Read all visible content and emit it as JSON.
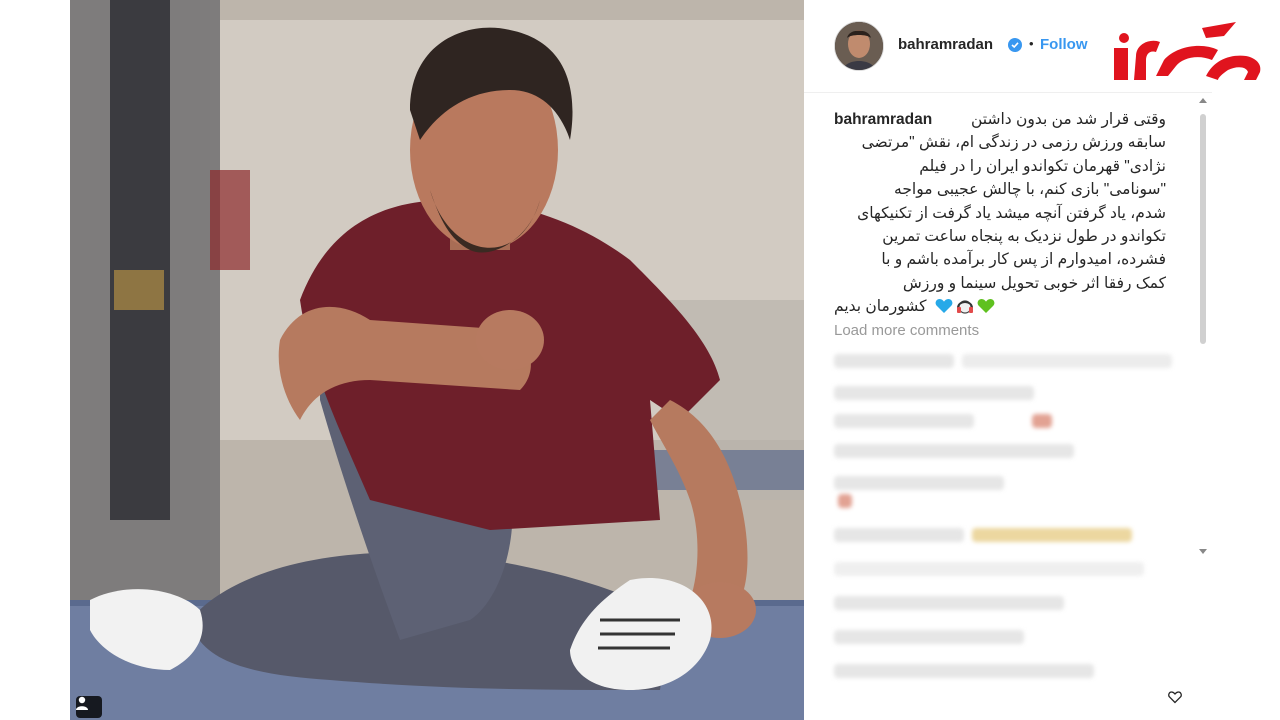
{
  "post": {
    "username": "bahramradan",
    "follow_label": "Follow",
    "separator": "•",
    "caption_user": "bahramradan",
    "caption_lines": [
      "وقتی قرار شد من بدون داشتن",
      "سابقه ورزش رزمی در زندگی ام، نقش \"مرتضی",
      "نژادی\" قهرمان تکواندو ایران را در فیلم",
      "\"سونامی\" بازی کنم، با چالش عجیبی مواجه",
      "شدم، یاد گرفتن آنچه میشد یاد گرفت از تکنیکهای",
      "تکواندو در طول نزدیک به پنجاه ساعت تمرین",
      "فشرده، امیدوارم از پس کار برآمده باشم و با",
      "کمک رفقا اثر خوبی تحویل سینما و ورزش",
      "کشورمان بدیم"
    ],
    "emojis": [
      "green-heart-icon",
      "headphones-icon",
      "blue-heart-icon"
    ],
    "load_more_label": "Load more comments"
  },
  "colors": {
    "accent": "#3897f0",
    "text": "#262626",
    "muted": "#999999",
    "logo_red": "#e0141e"
  },
  "icons": {
    "verified": "verified-badge-icon",
    "user_tag": "user-tag-icon",
    "heart": "heart-icon",
    "logo": "rokna-logo"
  }
}
